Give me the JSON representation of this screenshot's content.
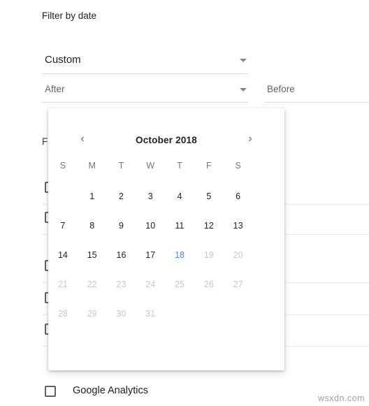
{
  "page": {
    "filter_title": "Filter by date",
    "custom_select": {
      "value": "Custom",
      "icon": "chevron-down-icon"
    },
    "after_field": {
      "value": "After",
      "icon": "chevron-down-icon"
    },
    "before_field": {
      "value": "Before"
    },
    "obscured_label": "F",
    "checkbox_items": [
      {
        "label": ""
      },
      {
        "label": ""
      },
      {
        "label": ""
      },
      {
        "label": ""
      },
      {
        "label": ""
      },
      {
        "label": "Google Analytics"
      }
    ],
    "watermark": "wsxdn.com"
  },
  "calendar": {
    "prev_icon": "chevron-left-icon",
    "next_icon": "chevron-right-icon",
    "month_label": "October 2018",
    "day_headers": [
      "S",
      "M",
      "T",
      "W",
      "T",
      "F",
      "S"
    ],
    "weeks": [
      [
        {
          "label": "",
          "state": "empty"
        },
        {
          "label": "1",
          "state": "normal"
        },
        {
          "label": "2",
          "state": "normal"
        },
        {
          "label": "3",
          "state": "normal"
        },
        {
          "label": "4",
          "state": "normal"
        },
        {
          "label": "5",
          "state": "normal"
        },
        {
          "label": "6",
          "state": "normal"
        }
      ],
      [
        {
          "label": "7",
          "state": "normal"
        },
        {
          "label": "8",
          "state": "normal"
        },
        {
          "label": "9",
          "state": "normal"
        },
        {
          "label": "10",
          "state": "normal"
        },
        {
          "label": "11",
          "state": "normal"
        },
        {
          "label": "12",
          "state": "normal"
        },
        {
          "label": "13",
          "state": "normal"
        }
      ],
      [
        {
          "label": "14",
          "state": "normal"
        },
        {
          "label": "15",
          "state": "normal"
        },
        {
          "label": "16",
          "state": "normal"
        },
        {
          "label": "17",
          "state": "normal"
        },
        {
          "label": "18",
          "state": "today"
        },
        {
          "label": "19",
          "state": "muted"
        },
        {
          "label": "20",
          "state": "muted"
        }
      ],
      [
        {
          "label": "21",
          "state": "muted"
        },
        {
          "label": "22",
          "state": "muted"
        },
        {
          "label": "23",
          "state": "muted"
        },
        {
          "label": "24",
          "state": "muted"
        },
        {
          "label": "25",
          "state": "muted"
        },
        {
          "label": "26",
          "state": "muted"
        },
        {
          "label": "27",
          "state": "muted"
        }
      ],
      [
        {
          "label": "28",
          "state": "muted"
        },
        {
          "label": "29",
          "state": "muted"
        },
        {
          "label": "30",
          "state": "muted"
        },
        {
          "label": "31",
          "state": "muted"
        },
        {
          "label": "",
          "state": "empty"
        },
        {
          "label": "",
          "state": "empty"
        },
        {
          "label": "",
          "state": "empty"
        }
      ]
    ]
  },
  "colors": {
    "accent": "#4285f4",
    "text": "#202124",
    "muted": "#c6c9cc",
    "secondary": "#70757a",
    "divider": "#e8eaed"
  }
}
